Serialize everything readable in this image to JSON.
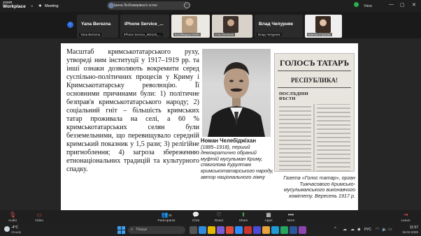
{
  "titlebar": {
    "brand_top": "zoom",
    "brand_bottom": "Workplace",
    "meeting_label": "Meeting",
    "meeting_pill": "Ірина Любомирівна's scree",
    "view_label": "View",
    "minimize": "—",
    "restore": "▢",
    "close": "✕"
  },
  "participants": [
    {
      "name_big": "Yana Berezna",
      "name_small": "Yana Berezna",
      "face_color": ""
    },
    {
      "name_big": "iPhone Service_...",
      "name_small": "iPhone Service_MD103_...",
      "face_color": ""
    },
    {
      "name_big": "",
      "name_small": "Колявіцька Юлія",
      "face_color": "#b49a7e"
    },
    {
      "name_big": "",
      "name_small": "Inna Беляєві",
      "face_color": "#6b5848"
    },
    {
      "name_big": "Влад Чепурняк",
      "name_small": "Влад Чепурняк",
      "face_color": ""
    },
    {
      "name_big": "",
      "name_small": "Іванна Строган",
      "face_color": "#c8b3a2"
    }
  ],
  "slide": {
    "body": "Масштаб кримськотатарського руху, утвореді ним інституції у 1917–1919 рр. та інші ознаки дозволяють вокремити серед суспільно-політичних процесів у Криму і Кримськотатарську революцію. Її основними причинами були: 1) політичне безправ'я кримськотатарського народу; 2) соціальний гніт – більшість кримських татар проживала на селі, а 60 % кримськотатарських селян були безземельними, що перевищувало середній кримський показник у 1,5 рази; 3) релігійне пригноблення; 4) загроза збереженню етнонаціональних традицій та культурного спадку.",
    "caption1_name": "Номан Челебіджіхан",
    "caption1_text": "(1885–1918), перший демократично обраний муфтій мусульман Криму, співголова Курултаю кримськотатарського народу, автор національного гімну",
    "caption2_text": "Газета «Голос татар», орган Тимчасового Кримсько-мусульманського виконавчого комітету. Вересень 1917 р.",
    "newspaper_title": "ГОЛОСЪ ТАТАРЪ",
    "newspaper_republic": "РЕСПУБЛИКА!",
    "newspaper_news": "ПОСЛѢДНІИ ВѢСТИ"
  },
  "toolbar": {
    "audio": "Audio",
    "video": "Video",
    "participants": "Participants",
    "participants_count": "76",
    "chat": "Chat",
    "react": "React",
    "share": "Share",
    "apps": "Apps",
    "more": "More",
    "leave": "Leave"
  },
  "taskbar": {
    "temp": "-4°C",
    "weather": "Cloudy",
    "search_placeholder": "Пошук",
    "lang": "РУС",
    "time": "11:57",
    "date": "19.02.2025"
  }
}
